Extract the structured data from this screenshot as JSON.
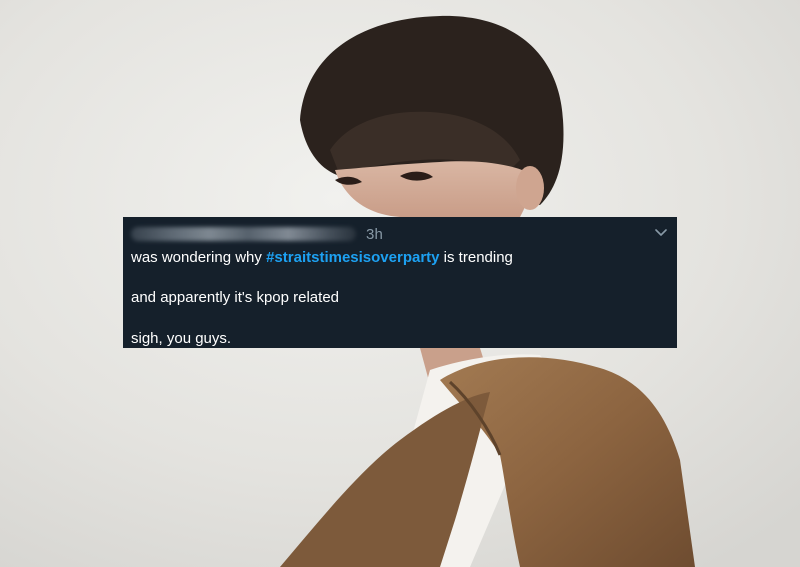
{
  "tweet": {
    "timestamp": "3h",
    "lines": {
      "line1_prefix": "was wondering why ",
      "hashtag": "#straitstimesisoverparty",
      "line1_suffix": " is trending",
      "line2": "and apparently it's kpop related",
      "line3": "sigh, you guys."
    },
    "menu_icon": "chevron-down-icon"
  },
  "colors": {
    "card_background": "#15202b",
    "hashtag": "#1da1f2",
    "timestamp": "#8899a6",
    "text": "#ffffff"
  }
}
